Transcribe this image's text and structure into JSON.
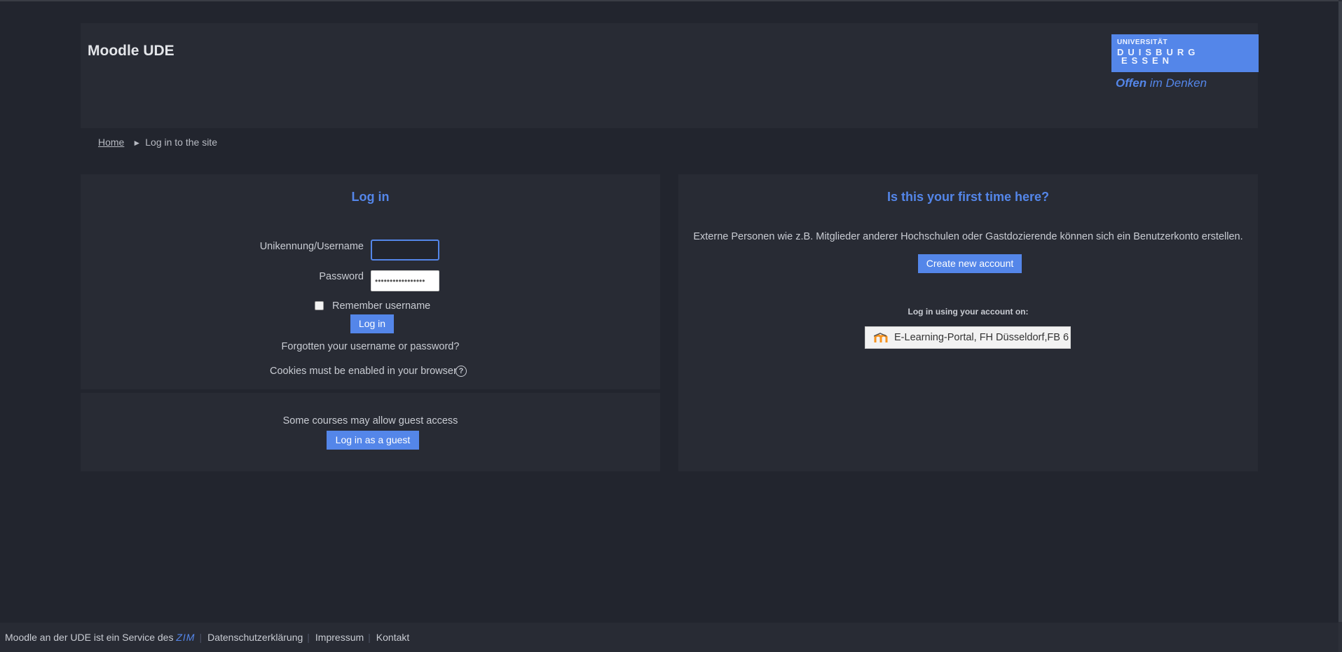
{
  "header": {
    "site_title": "Moodle UDE",
    "logo": {
      "line1": "UNIVERSITÄT",
      "line2": "DUISBURG",
      "line3": "ESSEN",
      "slogan_bold": "Offen",
      "slogan_rest": " im Denken"
    }
  },
  "breadcrumb": {
    "home": "Home",
    "separator": "►",
    "current": "Log in to the site"
  },
  "login": {
    "title": "Log in",
    "username_label": "Unikennung/Username",
    "username_value": "",
    "password_label": "Password",
    "password_value": "•••••••••••••••••",
    "remember_label": "Remember username",
    "remember_checked": false,
    "login_button": "Log in",
    "forgot_link": "Forgotten your username or password?",
    "cookies_text": "Cookies must be enabled in your browser"
  },
  "guest": {
    "text": "Some courses may allow guest access",
    "button": "Log in as a guest"
  },
  "signup": {
    "title": "Is this your first time here?",
    "description": "Externe Personen wie z.B. Mitglieder anderer Hochschulen oder Gastdozierende können sich ein Benutzerkonto erstellen.",
    "create_button": "Create new account",
    "idp_heading": "Log in using your account on:",
    "idp_button": "E-Learning-Portal, FH Düsseldorf,FB 6"
  },
  "footer": {
    "service_text": "Moodle an der UDE ist ein Service des ",
    "zim": "ZIM",
    "separator": "|",
    "links": [
      "Datenschutzerklärung",
      "Impressum",
      "Kontakt"
    ]
  },
  "colors": {
    "background": "#22252e",
    "panel": "#282b34",
    "accent": "#5486e9",
    "text": "#c9ccd3"
  }
}
